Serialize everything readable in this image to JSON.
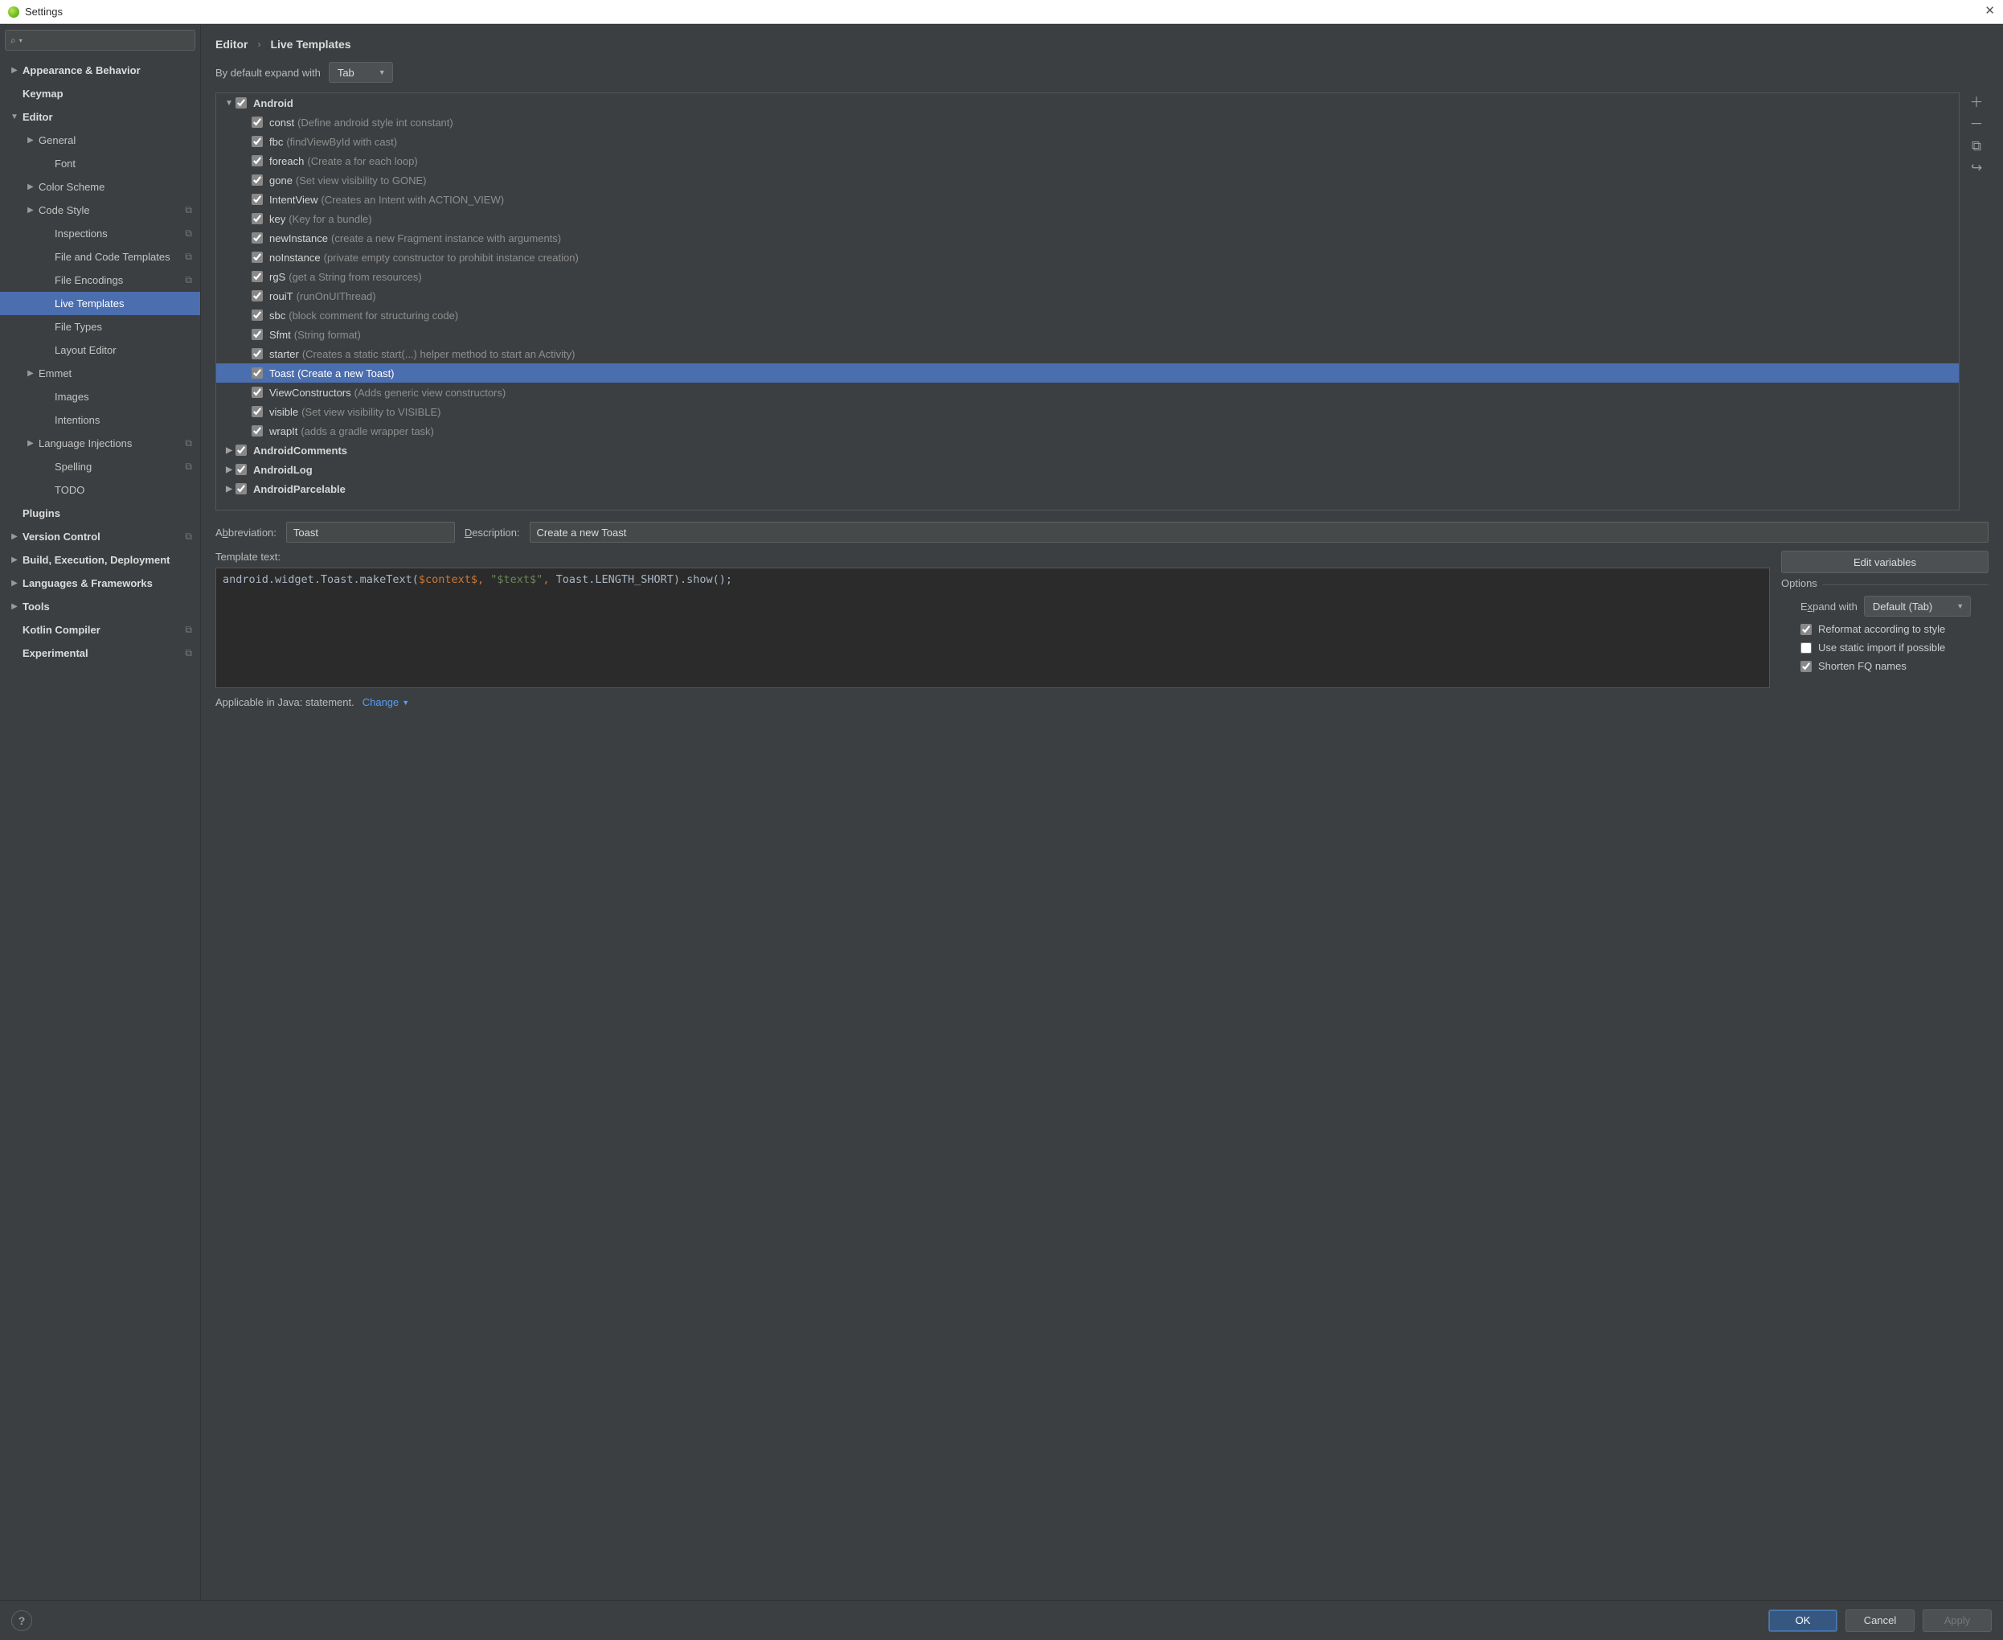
{
  "window": {
    "title": "Settings"
  },
  "search": {
    "placeholder": ""
  },
  "sidebar": [
    {
      "label": "Appearance & Behavior",
      "indent": 0,
      "arrow": "right",
      "bold": true
    },
    {
      "label": "Keymap",
      "indent": 0,
      "arrow": "none",
      "bold": true
    },
    {
      "label": "Editor",
      "indent": 0,
      "arrow": "down",
      "bold": true
    },
    {
      "label": "General",
      "indent": 1,
      "arrow": "right"
    },
    {
      "label": "Font",
      "indent": 2,
      "arrow": "none"
    },
    {
      "label": "Color Scheme",
      "indent": 1,
      "arrow": "right"
    },
    {
      "label": "Code Style",
      "indent": 1,
      "arrow": "right",
      "scheme": true
    },
    {
      "label": "Inspections",
      "indent": 2,
      "arrow": "none",
      "scheme": true
    },
    {
      "label": "File and Code Templates",
      "indent": 2,
      "arrow": "none",
      "scheme": true
    },
    {
      "label": "File Encodings",
      "indent": 2,
      "arrow": "none",
      "scheme": true
    },
    {
      "label": "Live Templates",
      "indent": 2,
      "arrow": "none",
      "selected": true
    },
    {
      "label": "File Types",
      "indent": 2,
      "arrow": "none"
    },
    {
      "label": "Layout Editor",
      "indent": 2,
      "arrow": "none"
    },
    {
      "label": "Emmet",
      "indent": 1,
      "arrow": "right"
    },
    {
      "label": "Images",
      "indent": 2,
      "arrow": "none"
    },
    {
      "label": "Intentions",
      "indent": 2,
      "arrow": "none"
    },
    {
      "label": "Language Injections",
      "indent": 1,
      "arrow": "right",
      "scheme": true
    },
    {
      "label": "Spelling",
      "indent": 2,
      "arrow": "none",
      "scheme": true
    },
    {
      "label": "TODO",
      "indent": 2,
      "arrow": "none"
    },
    {
      "label": "Plugins",
      "indent": 0,
      "arrow": "none",
      "bold": true
    },
    {
      "label": "Version Control",
      "indent": 0,
      "arrow": "right",
      "bold": true,
      "scheme": true
    },
    {
      "label": "Build, Execution, Deployment",
      "indent": 0,
      "arrow": "right",
      "bold": true
    },
    {
      "label": "Languages & Frameworks",
      "indent": 0,
      "arrow": "right",
      "bold": true
    },
    {
      "label": "Tools",
      "indent": 0,
      "arrow": "right",
      "bold": true
    },
    {
      "label": "Kotlin Compiler",
      "indent": 0,
      "arrow": "none",
      "bold": true,
      "scheme": true
    },
    {
      "label": "Experimental",
      "indent": 0,
      "arrow": "none",
      "bold": true,
      "scheme": true
    }
  ],
  "breadcrumbs": {
    "parent": "Editor",
    "current": "Live Templates"
  },
  "expand_default": {
    "label": "By default expand with",
    "value": "Tab"
  },
  "groups": [
    {
      "name": "Android",
      "expanded": true,
      "checked": true,
      "items": [
        {
          "name": "const",
          "desc": "(Define android style int constant)",
          "checked": true
        },
        {
          "name": "fbc",
          "desc": "(findViewById with cast)",
          "checked": true
        },
        {
          "name": "foreach",
          "desc": "(Create a for each loop)",
          "checked": true
        },
        {
          "name": "gone",
          "desc": "(Set view visibility to GONE)",
          "checked": true
        },
        {
          "name": "IntentView",
          "desc": "(Creates an Intent with ACTION_VIEW)",
          "checked": true
        },
        {
          "name": "key",
          "desc": "(Key for a bundle)",
          "checked": true
        },
        {
          "name": "newInstance",
          "desc": "(create a new Fragment instance with arguments)",
          "checked": true
        },
        {
          "name": "noInstance",
          "desc": "(private empty constructor to prohibit instance creation)",
          "checked": true
        },
        {
          "name": "rgS",
          "desc": "(get a String from resources)",
          "checked": true
        },
        {
          "name": "rouiT",
          "desc": "(runOnUIThread)",
          "checked": true
        },
        {
          "name": "sbc",
          "desc": "(block comment for structuring code)",
          "checked": true
        },
        {
          "name": "Sfmt",
          "desc": "(String format)",
          "checked": true
        },
        {
          "name": "starter",
          "desc": "(Creates a static start(...) helper method to start an Activity)",
          "checked": true
        },
        {
          "name": "Toast",
          "desc": "(Create a new Toast)",
          "checked": true,
          "selected": true
        },
        {
          "name": "ViewConstructors",
          "desc": "(Adds generic view constructors)",
          "checked": true
        },
        {
          "name": "visible",
          "desc": "(Set view visibility to VISIBLE)",
          "checked": true
        },
        {
          "name": "wrapIt",
          "desc": "(adds a gradle wrapper task)",
          "checked": true
        }
      ]
    },
    {
      "name": "AndroidComments",
      "expanded": false,
      "checked": true
    },
    {
      "name": "AndroidLog",
      "expanded": false,
      "checked": true
    },
    {
      "name": "AndroidParcelable",
      "expanded": false,
      "checked": true
    }
  ],
  "detail": {
    "abbr_label": "Abbreviation:",
    "abbr_value": "Toast",
    "desc_label": "Description:",
    "desc_value": "Create a new Toast",
    "tpl_label": "Template text:",
    "template_tokens": [
      {
        "t": "android.widget.Toast.makeText(",
        "c": "plain"
      },
      {
        "t": "$context$",
        "c": "var"
      },
      {
        "t": ",",
        "c": "pun"
      },
      {
        "t": " ",
        "c": "plain"
      },
      {
        "t": "\"$text$\"",
        "c": "str"
      },
      {
        "t": ",",
        "c": "pun"
      },
      {
        "t": " Toast.LENGTH_SHORT).show();",
        "c": "plain"
      }
    ],
    "edit_vars": "Edit variables",
    "options_label": "Options",
    "expand_with_label": "Expand with",
    "expand_with_value": "Default (Tab)",
    "opt_reformat": "Reformat according to style",
    "opt_static_import": "Use static import if possible",
    "opt_shorten_fq": "Shorten FQ names",
    "opt_reformat_checked": true,
    "opt_static_import_checked": false,
    "opt_shorten_fq_checked": true,
    "applicable": "Applicable in Java: statement.",
    "change": "Change"
  },
  "footer": {
    "ok": "OK",
    "cancel": "Cancel",
    "apply": "Apply"
  }
}
